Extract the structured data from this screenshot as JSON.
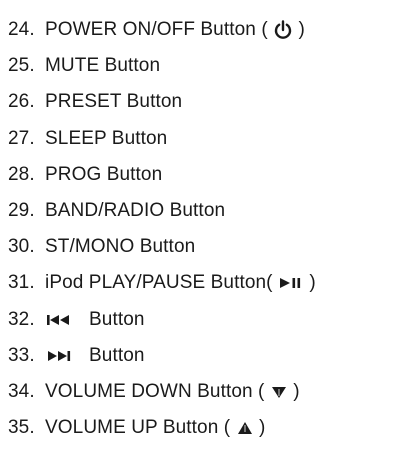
{
  "items": [
    {
      "num": "24.",
      "pre": "POWER ON/OFF Button ( ",
      "icon": "power-icon",
      "post": " )"
    },
    {
      "num": "25.",
      "text": "MUTE Button"
    },
    {
      "num": "26.",
      "text": "PRESET Button"
    },
    {
      "num": "27.",
      "text": "SLEEP Button"
    },
    {
      "num": "28.",
      "text": "PROG Button"
    },
    {
      "num": "29.",
      "text": "BAND/RADIO Button"
    },
    {
      "num": "30.",
      "text": "ST/MONO Button"
    },
    {
      "num": "31.",
      "pre": "iPod PLAY/PAUSE Button( ",
      "icon": "play-pause-icon",
      "post": " )"
    },
    {
      "num": "32.",
      "icon": "skip-back-icon",
      "post": "Button"
    },
    {
      "num": "33.",
      "icon": "skip-forward-icon",
      "post": "Button"
    },
    {
      "num": "34.",
      "pre": "VOLUME DOWN Button ( ",
      "icon": "triangle-down-icon",
      "post": " )"
    },
    {
      "num": "35.",
      "pre": "VOLUME UP Button ( ",
      "icon": "triangle-up-icon",
      "post": " )"
    }
  ]
}
